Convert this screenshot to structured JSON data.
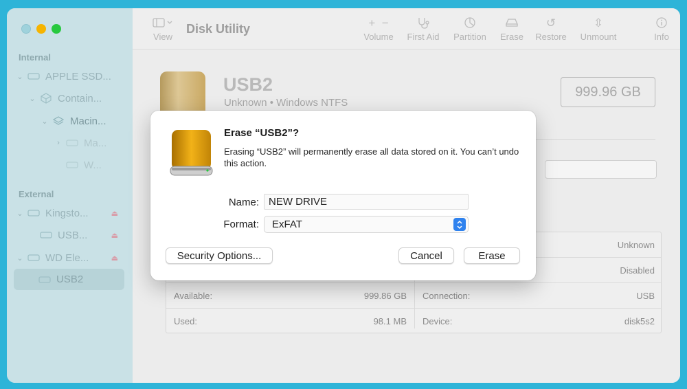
{
  "app": {
    "title": "Disk Utility"
  },
  "sidebar": {
    "internal_heading": "Internal",
    "external_heading": "External",
    "internal_items": [
      {
        "label": "APPLE SSD...",
        "icon": "drive-icon"
      },
      {
        "label": "Contain...",
        "icon": "container-icon"
      },
      {
        "label": "Macin...",
        "icon": "volume-stack-icon"
      },
      {
        "label": "Ma...",
        "icon": "drive-icon"
      },
      {
        "label": "W...",
        "icon": "drive-icon"
      }
    ],
    "external_items": [
      {
        "label": "Kingsto...",
        "icon": "drive-icon"
      },
      {
        "label": "USB...",
        "icon": "drive-icon"
      },
      {
        "label": "WD Ele...",
        "icon": "drive-icon"
      },
      {
        "label": "USB2",
        "icon": "drive-icon",
        "selected": true
      }
    ]
  },
  "toolbar": {
    "view_label": "View",
    "volume_label": "Volume",
    "first_aid_label": "First Aid",
    "partition_label": "Partition",
    "erase_label": "Erase",
    "restore_label": "Restore",
    "unmount_label": "Unmount",
    "info_label": "Info"
  },
  "disk": {
    "name": "USB2",
    "subtitle": "Unknown • Windows NTFS",
    "size": "999.96 GB"
  },
  "info": {
    "available_label": "Available:",
    "available_value": "999.86 GB",
    "used_label": "Used:",
    "used_value": "98.1 MB",
    "connection_label": "Connection:",
    "connection_value": "USB",
    "device_label": "Device:",
    "device_value": "disk5s2",
    "row1_value": "Unknown",
    "row2_value": "Disabled"
  },
  "dialog": {
    "title": "Erase “USB2”?",
    "message": "Erasing “USB2” will permanently erase all data stored on it. You can’t undo this action.",
    "name_label": "Name:",
    "name_value": "NEW DRIVE",
    "format_label": "Format:",
    "format_value": "ExFAT",
    "security_button": "Security Options...",
    "cancel_button": "Cancel",
    "erase_button": "Erase"
  },
  "colors": {
    "desktop": "#2eb4d8",
    "accent": "#2f82ee",
    "sidebar": "#c9e1e6"
  }
}
